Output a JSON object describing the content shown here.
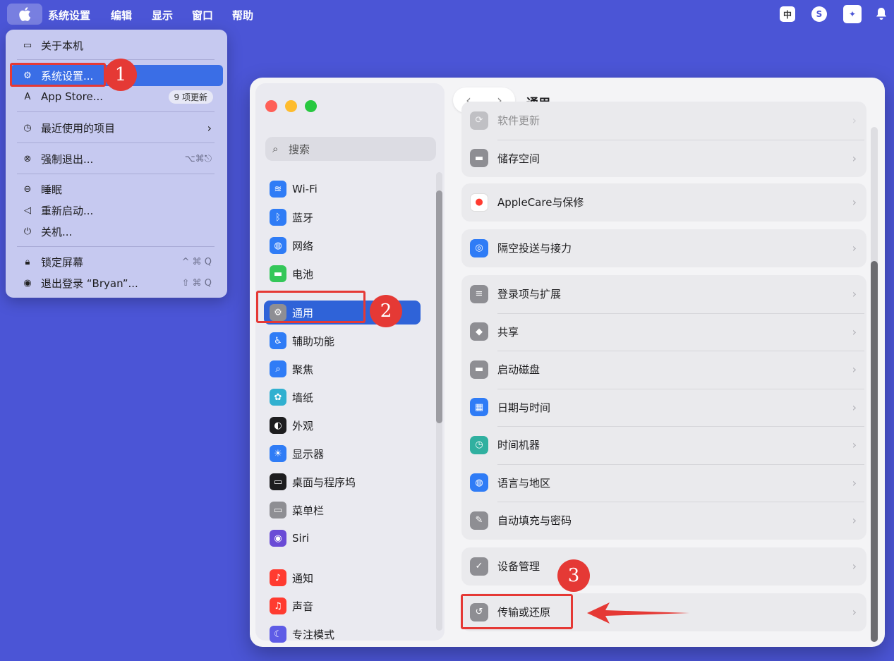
{
  "menubar": {
    "app_name": "系统设置",
    "items": [
      "编辑",
      "显示",
      "窗口",
      "帮助"
    ],
    "status_icons": {
      "input_method": "中"
    }
  },
  "apple_menu": {
    "about": "关于本机",
    "system_settings": "系统设置...",
    "app_store": "App Store...",
    "app_store_badge": "9 项更新",
    "recent_items": "最近使用的项目",
    "force_quit": "强制退出...",
    "force_quit_shortcut": "⌥⌘⎋",
    "sleep": "睡眠",
    "restart": "重新启动...",
    "shutdown": "关机...",
    "lock_screen": "锁定屏幕",
    "lock_screen_shortcut": "^ ⌘ Q",
    "logout": "退出登录 “Bryan”...",
    "logout_shortcut": "⇧ ⌘ Q"
  },
  "sidebar": {
    "search_placeholder": "搜索",
    "items": [
      {
        "label": "Wi-Fi",
        "icon": "wifi-icon",
        "color": "#2f7cf6"
      },
      {
        "label": "蓝牙",
        "icon": "bluetooth-icon",
        "color": "#2f7cf6"
      },
      {
        "label": "网络",
        "icon": "globe-icon",
        "color": "#2f7cf6"
      },
      {
        "label": "电池",
        "icon": "battery-icon",
        "color": "#34c759"
      },
      {
        "label": "通用",
        "icon": "gear-icon",
        "color": "#8e8e93"
      },
      {
        "label": "辅助功能",
        "icon": "accessibility-icon",
        "color": "#2f7cf6"
      },
      {
        "label": "聚焦",
        "icon": "magnifier-icon",
        "color": "#2f7cf6"
      },
      {
        "label": "墙纸",
        "icon": "flower-icon",
        "color": "#30b0d0"
      },
      {
        "label": "外观",
        "icon": "appearance-icon",
        "color": "#1d1d1f"
      },
      {
        "label": "显示器",
        "icon": "brightness-icon",
        "color": "#2f7cf6"
      },
      {
        "label": "桌面与程序坞",
        "icon": "dock-icon",
        "color": "#1d1d1f"
      },
      {
        "label": "菜单栏",
        "icon": "menubar-icon",
        "color": "#8e8e93"
      },
      {
        "label": "Siri",
        "icon": "siri-icon",
        "color": "#6a4bd6"
      },
      {
        "label": "通知",
        "icon": "bell-icon",
        "color": "#ff3b30"
      },
      {
        "label": "声音",
        "icon": "speaker-icon",
        "color": "#ff3b30"
      },
      {
        "label": "专注模式",
        "icon": "moon-icon",
        "color": "#5e5ce6"
      }
    ]
  },
  "content": {
    "title": "通用",
    "groups": [
      [
        "软件更新",
        "储存空间"
      ],
      [
        "AppleCare与保修"
      ],
      [
        "隔空投送与接力"
      ],
      [
        "登录项与扩展",
        "共享",
        "启动磁盘",
        "日期与时间",
        "时间机器",
        "语言与地区",
        "自动填充与密码"
      ],
      [
        "设备管理"
      ],
      [
        "传输或还原"
      ]
    ]
  },
  "annotations": {
    "step1": "1",
    "step2": "2",
    "step3": "3"
  }
}
